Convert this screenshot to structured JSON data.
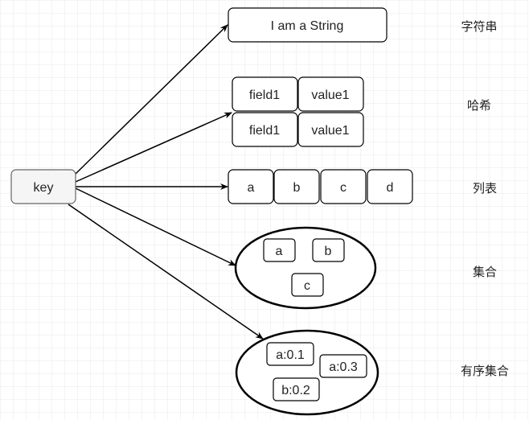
{
  "key": "key",
  "string": {
    "value": "I am a String",
    "label": "字符串"
  },
  "hash": {
    "rows": [
      [
        "field1",
        "value1"
      ],
      [
        "field1",
        "value1"
      ]
    ],
    "label": "哈希"
  },
  "list": {
    "items": [
      "a",
      "b",
      "c",
      "d"
    ],
    "label": "列表"
  },
  "set": {
    "items": [
      "a",
      "b",
      "c"
    ],
    "label": "集合"
  },
  "zset": {
    "items": [
      "a:0.1",
      "a:0.3",
      "b:0.2"
    ],
    "label": "有序集合"
  },
  "colors": {
    "key_fill": "#f5f5f5",
    "key_stroke": "#666666",
    "stroke": "#000000",
    "grid": "#e6e6e6"
  }
}
